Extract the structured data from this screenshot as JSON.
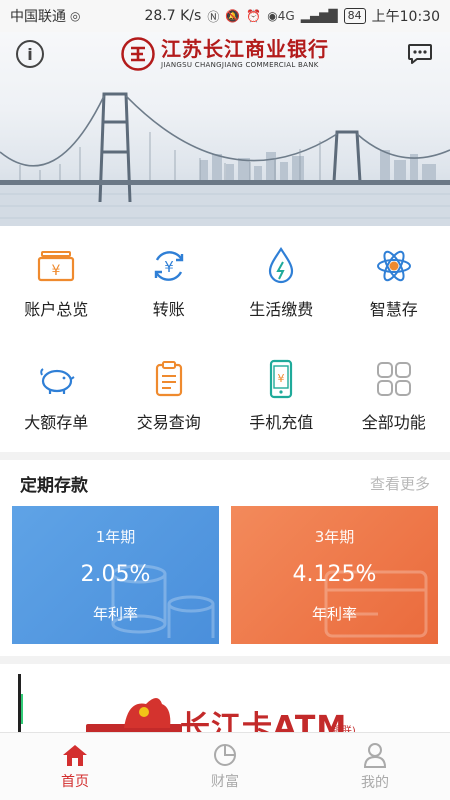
{
  "status_bar": {
    "carrier": "中国联通",
    "speed": "28.7 K/s",
    "network": "4G",
    "battery": "84",
    "time": "上午10:30"
  },
  "header": {
    "bank_name_cn": "江苏长江商业银行",
    "bank_name_en": "JIANGSU CHANGJIANG COMMERCIAL BANK",
    "info_icon": "info-icon",
    "message_icon": "chat-bubble-icon"
  },
  "quick_actions": [
    {
      "label": "账户总览",
      "icon": "yuan-box-icon"
    },
    {
      "label": "转账",
      "icon": "yuan-exchange-icon"
    },
    {
      "label": "生活缴费",
      "icon": "water-drop-icon"
    },
    {
      "label": "智慧存",
      "icon": "atom-icon"
    },
    {
      "label": "大额存单",
      "icon": "piggy-bank-icon"
    },
    {
      "label": "交易查询",
      "icon": "clipboard-icon"
    },
    {
      "label": "手机充值",
      "icon": "phone-yuan-icon"
    },
    {
      "label": "全部功能",
      "icon": "grid-squares-icon"
    }
  ],
  "deposits": {
    "title": "定期存款",
    "more": "查看更多",
    "cards": [
      {
        "term": "1年期",
        "rate": "2.05%",
        "sub": "年利率",
        "color": "#5a9de3"
      },
      {
        "term": "3年期",
        "rate": "4.125%",
        "sub": "年利率",
        "color": "#ef7a4c"
      }
    ]
  },
  "ad": {
    "title": "长江卡ATM",
    "sub": "(银联)"
  },
  "nav": [
    {
      "label": "首页",
      "icon": "home-icon",
      "active": true
    },
    {
      "label": "财富",
      "icon": "pie-chart-icon",
      "active": false
    },
    {
      "label": "我的",
      "icon": "person-icon",
      "active": false
    }
  ],
  "colors": {
    "brand_red": "#b31b1b",
    "active_red": "#d32f2f",
    "icon_orange": "#ef8a2e",
    "icon_blue": "#2f7fd6",
    "icon_teal": "#1faa9a"
  }
}
